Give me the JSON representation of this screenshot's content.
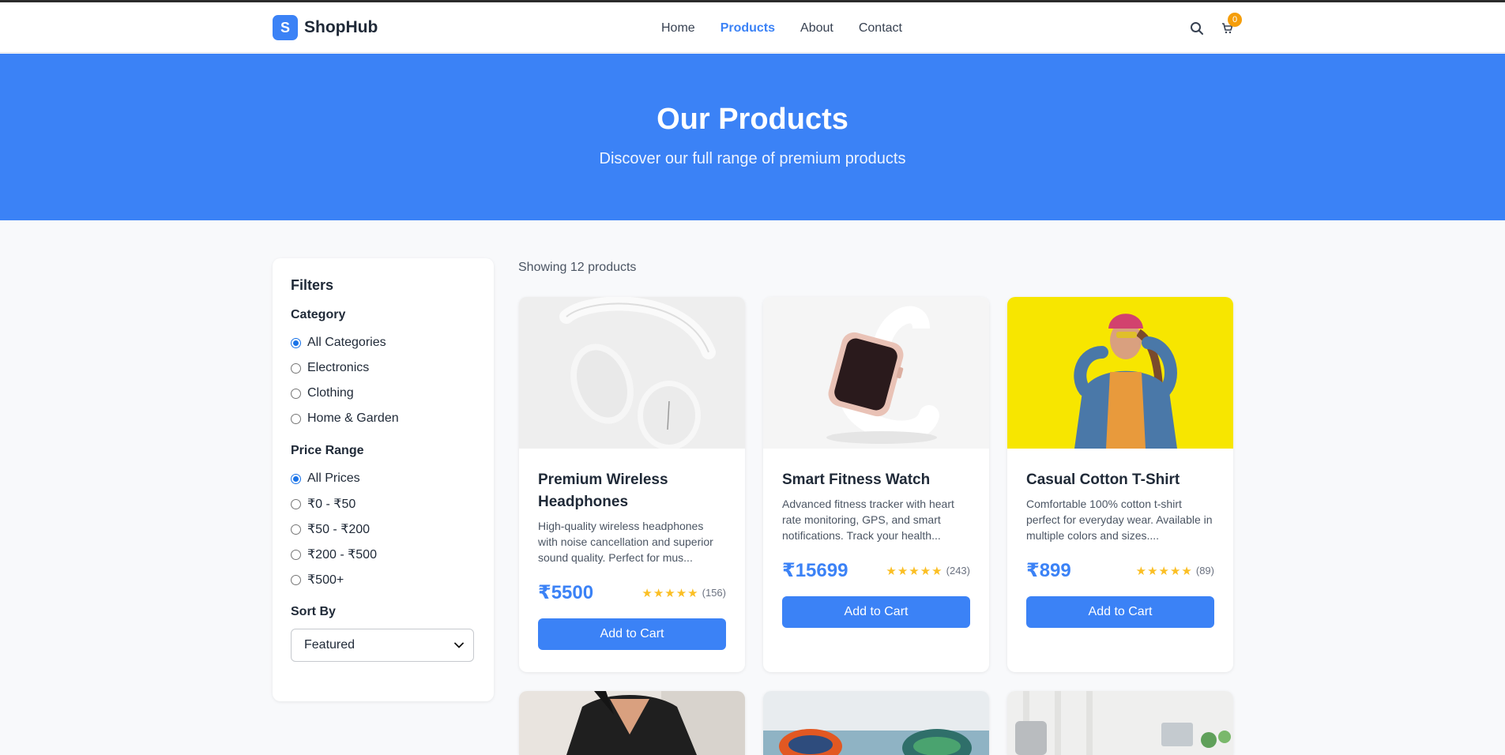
{
  "navbar": {
    "logo_letter": "S",
    "brand": "ShopHub",
    "links": [
      {
        "label": "Home",
        "active": false
      },
      {
        "label": "Products",
        "active": true
      },
      {
        "label": "About",
        "active": false
      },
      {
        "label": "Contact",
        "active": false
      }
    ],
    "cart_count": "0"
  },
  "hero": {
    "title": "Our Products",
    "subtitle": "Discover our full range of premium products"
  },
  "filters": {
    "title": "Filters",
    "category": {
      "title": "Category",
      "options": [
        "All Categories",
        "Electronics",
        "Clothing",
        "Home & Garden"
      ],
      "selected": "All Categories"
    },
    "price": {
      "title": "Price Range",
      "options": [
        "All Prices",
        "₹0 - ₹50",
        "₹50 - ₹200",
        "₹200 - ₹500",
        "₹500+"
      ],
      "selected": "All Prices"
    },
    "sort": {
      "title": "Sort By",
      "value": "Featured"
    }
  },
  "results_text": "Showing 12 products",
  "products": [
    {
      "title": "Premium Wireless Headphones",
      "description": "High-quality wireless headphones with noise cancellation and superior sound quality. Perfect for mus...",
      "price": "₹5500",
      "rating_stars": "★★★★★",
      "reviews": "(156)",
      "button": "Add to Cart",
      "image": "headphones-image"
    },
    {
      "title": "Smart Fitness Watch",
      "description": "Advanced fitness tracker with heart rate monitoring, GPS, and smart notifications. Track your health...",
      "price": "₹15699",
      "rating_stars": "★★★★★",
      "reviews": "(243)",
      "button": "Add to Cart",
      "image": "smartwatch-image"
    },
    {
      "title": "Casual Cotton T-Shirt",
      "description": "Comfortable 100% cotton t-shirt perfect for everyday wear. Available in multiple colors and sizes....",
      "price": "₹899",
      "rating_stars": "★★★★★",
      "reviews": "(89)",
      "button": "Add to Cart",
      "image": "tshirt-model-image"
    }
  ],
  "colors": {
    "primary": "#3b82f6",
    "badge": "#f59e0b",
    "star": "#fbbf24"
  }
}
